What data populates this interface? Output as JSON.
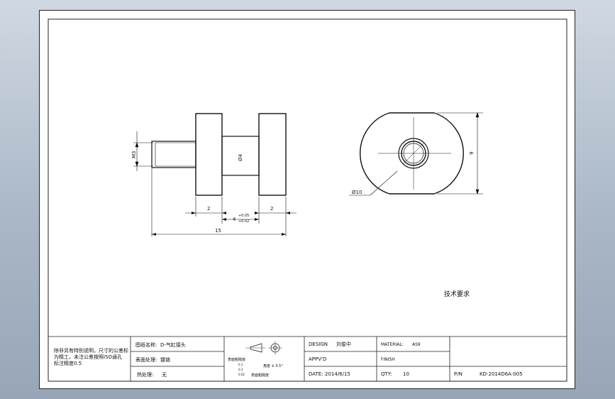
{
  "views": {
    "front": {
      "thread_label": "M3",
      "center_diameter_label": "Ø4",
      "dim_left_width": "2",
      "dim_right_width": "2",
      "dim_middle": "4",
      "tol_upper": "+0.05",
      "tol_lower": "+0.02",
      "dim_total": "15"
    },
    "side": {
      "diameter_label": "Ø10",
      "height_dim": "9"
    }
  },
  "notes": {
    "tech_requirements": "技术要求"
  },
  "title_block": {
    "note_line1": "除非另有特别说明，尺寸的公差标",
    "note_line2": "为精工，未注公差按照ISO通孔",
    "note_line3": "标注精度0.5",
    "part_name_label": "图纸名称:",
    "part_name_value": "D-气缸接头",
    "surface_label": "表面处理:",
    "surface_value": "镀铬",
    "heat_label": "热处理:",
    "heat_value": "无",
    "roughness_title": "表面粗糙度",
    "roughness_l1": "0.1",
    "roughness_l2": "0.3",
    "roughness_l3": "0.02",
    "roughness_bottom": "表面粗糙度",
    "angle_label": "角度 ± 0.5°",
    "design_label": "DESIGN",
    "design_value": "刘俊中",
    "appvd_label": "APPV'D",
    "date_label": "DATE:",
    "date_value": "2014/6/15",
    "material_label": "MATERIAL:",
    "material_value": "AS9",
    "finish_label": "FINISH",
    "qty_label": "QTY:",
    "qty_value": "10",
    "pn_label": "P/N",
    "pn_value": "KD-2014D6A-005"
  }
}
